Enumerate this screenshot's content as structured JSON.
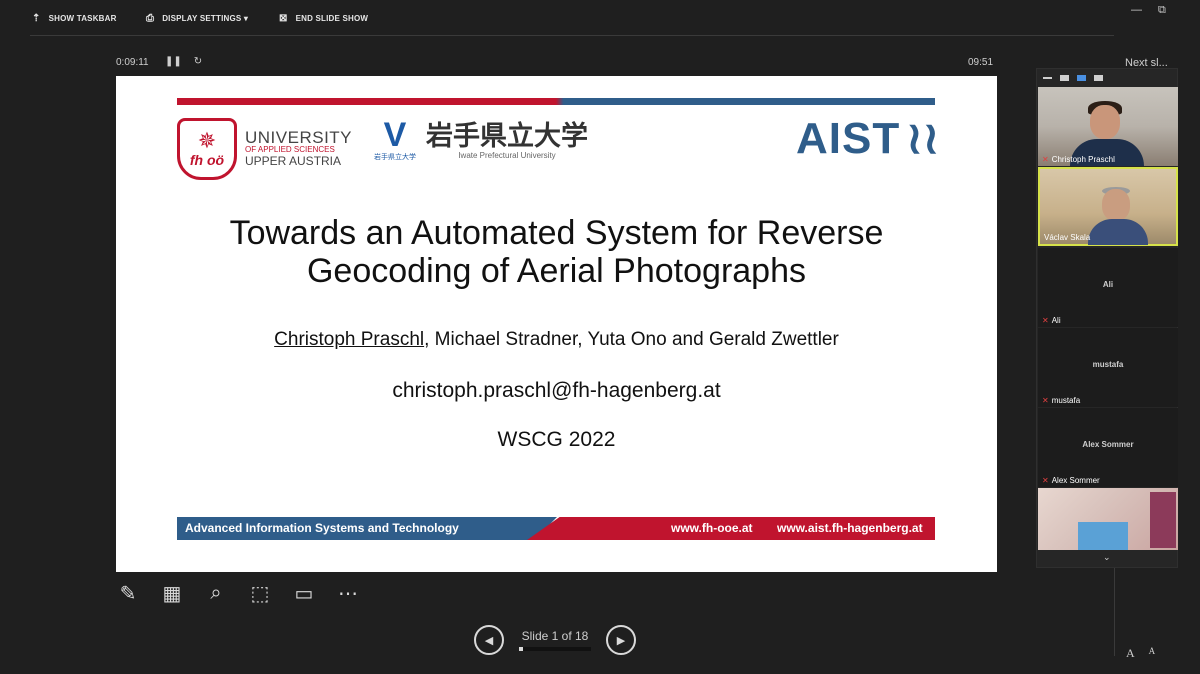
{
  "toolbar": {
    "show_taskbar": "SHOW TASKBAR",
    "display_settings": "DISPLAY SETTINGS ▾",
    "end_slideshow": "END SLIDE SHOW"
  },
  "window_controls": {
    "minimize": "—",
    "restore": "⧉"
  },
  "timer": {
    "time": "0:09:11",
    "pause_icon": "pause-icon",
    "restart_icon": "restart-icon"
  },
  "clock": "09:51",
  "next_slide_label": "Next sl...",
  "slide": {
    "logo_fh": {
      "line1": "UNIVERSITY",
      "line2": "OF APPLIED SCIENCES",
      "line3": "UPPER AUSTRIA",
      "badge": "fh oö"
    },
    "logo_iwate": {
      "jp_name": "岩手県立大学",
      "en_name": "Iwate Prefectural University",
      "small_jp": "岩手県立大学"
    },
    "logo_aist": {
      "text": "AIST"
    },
    "title_line1": "Towards an Automated System for Reverse",
    "title_line2": "Geocoding of Aerial Photographs",
    "author_first": "Christoph Praschl",
    "author_rest": ", Michael Stradner, Yuta Ono and Gerald Zwettler",
    "email": "christoph.praschl@fh-hagenberg.at",
    "conference": "WSCG 2022",
    "footer_left": "Advanced Information Systems and Technology",
    "footer_url1": "www.fh-ooe.at",
    "footer_url2": "www.aist.fh-hagenberg.at"
  },
  "tools": [
    "pen-icon",
    "slides-grid-icon",
    "zoom-icon",
    "laser-pointer-icon",
    "subtitles-icon",
    "more-options-icon"
  ],
  "navigation": {
    "prev": "◀",
    "next": "▶",
    "counter": "Slide 1 of 18",
    "progress": 0.0556
  },
  "font_controls": {
    "increase": "A",
    "decrease": "A"
  },
  "gallery": {
    "participants": [
      {
        "name": "Christoph Praschl",
        "video": true
      },
      {
        "name": "Václav Skala",
        "video": true
      },
      {
        "name": "Ali",
        "video": false
      },
      {
        "name": "mustafa",
        "video": false
      },
      {
        "name": "Alex Sommer",
        "video": false
      },
      {
        "name": "",
        "video": true
      }
    ]
  },
  "colors": {
    "red": "#c0142e",
    "blue": "#2f5d8a",
    "background": "#1f1f1f"
  }
}
